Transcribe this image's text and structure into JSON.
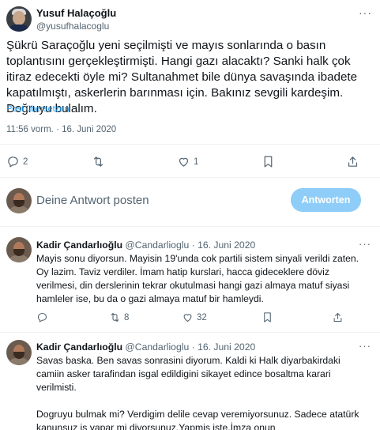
{
  "tweet": {
    "author_name": "Yusuf Halaçoğlu",
    "author_handle": "@yusufhalacoglu",
    "more": "···",
    "text": "Şükrü Saraçoğlu yeni seçilmişti ve mayıs sonlarında o basın toplantısını gerçekleştirmişti. Hangi gazı alacaktı? Sanki halk çok itiraz edecekti öyle mi? Sultanahmet bile dünya savaşında ibadete kapatılmıştı, askerlerin barınması için. Bakınız sevgili kardeşim. Doğruyu bulalım.",
    "translate_link": "Post übersetzen",
    "timestamp": "11:56 vorm. · 16. Juni 2020",
    "actions": {
      "replies": "2",
      "retweets": "",
      "likes": "1",
      "bookmark_icon": "bookmark-icon",
      "share_icon": "share-icon"
    }
  },
  "composer": {
    "placeholder": "Deine Antwort posten",
    "reply_button": "Antworten"
  },
  "replies": [
    {
      "author_name": "Kadir Çandarlıoğlu",
      "author_handle": "@Candarlioglu",
      "date": "· 16. Juni 2020",
      "more": "···",
      "text": "Mayis sonu diyorsun. Mayisin 19'unda cok partili sistem sinyali verildi zaten. Oy lazim. Taviz verdiler. İmam hatip kurslari, hacca gideceklere döviz verilmesi, din derslerinin tekrar okutulmasi hangi gazi almaya matuf siyasi hamleler ise, bu da o gazi almaya matuf bir hamleydi.",
      "actions": {
        "replies": "",
        "retweets": "8",
        "likes": "32"
      }
    },
    {
      "author_name": "Kadir Çandarlıoğlu",
      "author_handle": "@Candarlioglu",
      "date": "· 16. Juni 2020",
      "more": "···",
      "text": "Savas baska. Ben savas sonrasini diyorum. Kaldi ki Halk diyarbakirdaki camiin asker tarafindan isgal edildigini sikayet edince bosaltma karari verilmisti.\n\nDogruyu bulmak mi? Verdigim delile cevap veremiyorsunuz. Sadece atatürk kanunsuz is yapar mi diyorsunuz.Yapmis iste.İmza onun"
    }
  ]
}
